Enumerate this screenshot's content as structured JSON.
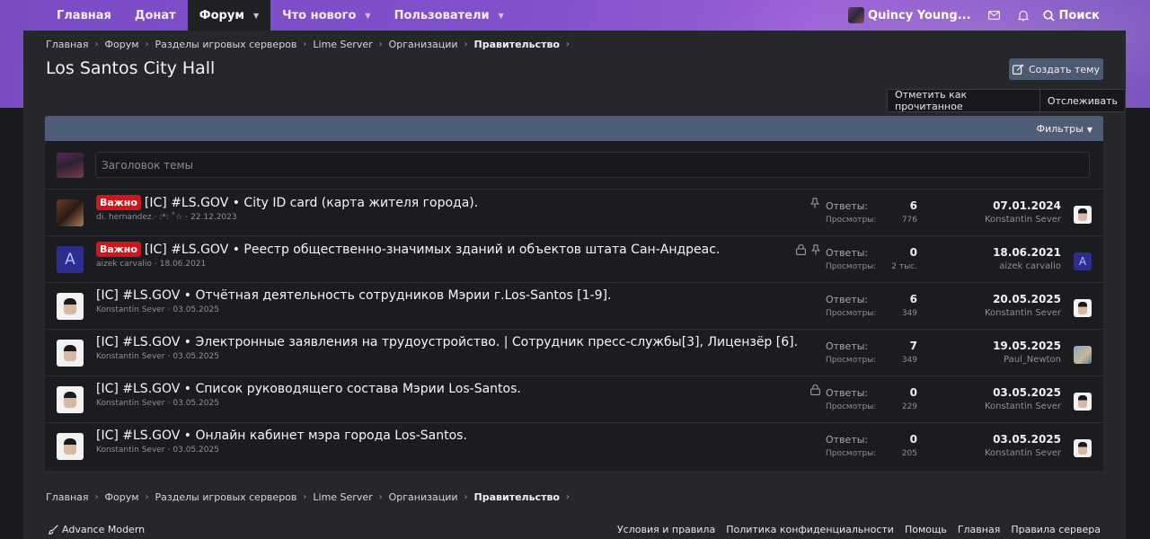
{
  "nav": {
    "tabs": [
      {
        "label": "Главная"
      },
      {
        "label": "Донат"
      },
      {
        "label": "Форум"
      },
      {
        "label": "Что нового"
      },
      {
        "label": "Пользователи"
      }
    ],
    "active_tab": "Форум",
    "user_name": "Quincy Young...",
    "search_label": "Поиск"
  },
  "breadcrumb": [
    "Главная",
    "Форум",
    "Разделы игровых серверов",
    "Lime Server",
    "Организации",
    "Правительство"
  ],
  "page_title": "Los Santos City Hall",
  "actions": {
    "create_thread": "Создать тему",
    "mark_read": "Отметить как прочитанное",
    "watch": "Отслеживать"
  },
  "filter_label": "Фильтры",
  "new_thread_placeholder": "Заголовок темы",
  "labels": {
    "replies": "Ответы:",
    "views": "Просмотры:"
  },
  "threads": [
    {
      "badge": "Важно",
      "title": "[IC] #LS.GOV • City ID card (карта жителя города).",
      "author": "di. hernandez.· :*: ˚☆",
      "date": "22.12.2023",
      "replies": "6",
      "views": "776",
      "last_date": "07.01.2024",
      "last_user": "Konstantin Sever",
      "pinned": true,
      "locked": false
    },
    {
      "badge": "Важно",
      "title": "[IC] #LS.GOV • Реестр общественно-значимых зданий и объектов штата Сан-Андреас.",
      "author": "aizek carvalio",
      "date": "18.06.2021",
      "replies": "0",
      "views": "2 тыс.",
      "last_date": "18.06.2021",
      "last_user": "aizek carvalio",
      "pinned": true,
      "locked": true,
      "avatar_letter": "A"
    },
    {
      "badge": "",
      "title": "[IC] #LS.GOV • Отчётная деятельность сотрудников Мэрии г.Los-Santos [1-9].",
      "author": "Konstantin Sever",
      "date": "03.05.2025",
      "replies": "6",
      "views": "349",
      "last_date": "20.05.2025",
      "last_user": "Konstantin Sever",
      "pinned": false,
      "locked": false
    },
    {
      "badge": "",
      "title": "[IC] #LS.GOV • Электронные заявления на трудоустройство. | Сотрудник пресс-службы[3], Лицензёр [6].",
      "author": "Konstantin Sever",
      "date": "03.05.2025",
      "replies": "7",
      "views": "349",
      "last_date": "19.05.2025",
      "last_user": "Paul_Newton",
      "pinned": false,
      "locked": false
    },
    {
      "badge": "",
      "title": "[IC] #LS.GOV • Список руководящего состава Мэрии Los-Santos.",
      "author": "Konstantin Sever",
      "date": "03.05.2025",
      "replies": "0",
      "views": "229",
      "last_date": "03.05.2025",
      "last_user": "Konstantin Sever",
      "pinned": false,
      "locked": true
    },
    {
      "badge": "",
      "title": "[IC] #LS.GOV • Онлайн кабинет мэра города Los-Santos.",
      "author": "Konstantin Sever",
      "date": "03.05.2025",
      "replies": "0",
      "views": "205",
      "last_date": "03.05.2025",
      "last_user": "Konstantin Sever",
      "pinned": false,
      "locked": false
    }
  ],
  "footer": {
    "style_label": "Advance Modern",
    "links": [
      "Условия и правила",
      "Политика конфиденциальности",
      "Помощь",
      "Главная",
      "Правила сервера"
    ]
  },
  "colors": {
    "accent_bar": "#4f5c77",
    "badge_important": "#d2151c",
    "hero_purple": "#8150cc"
  }
}
